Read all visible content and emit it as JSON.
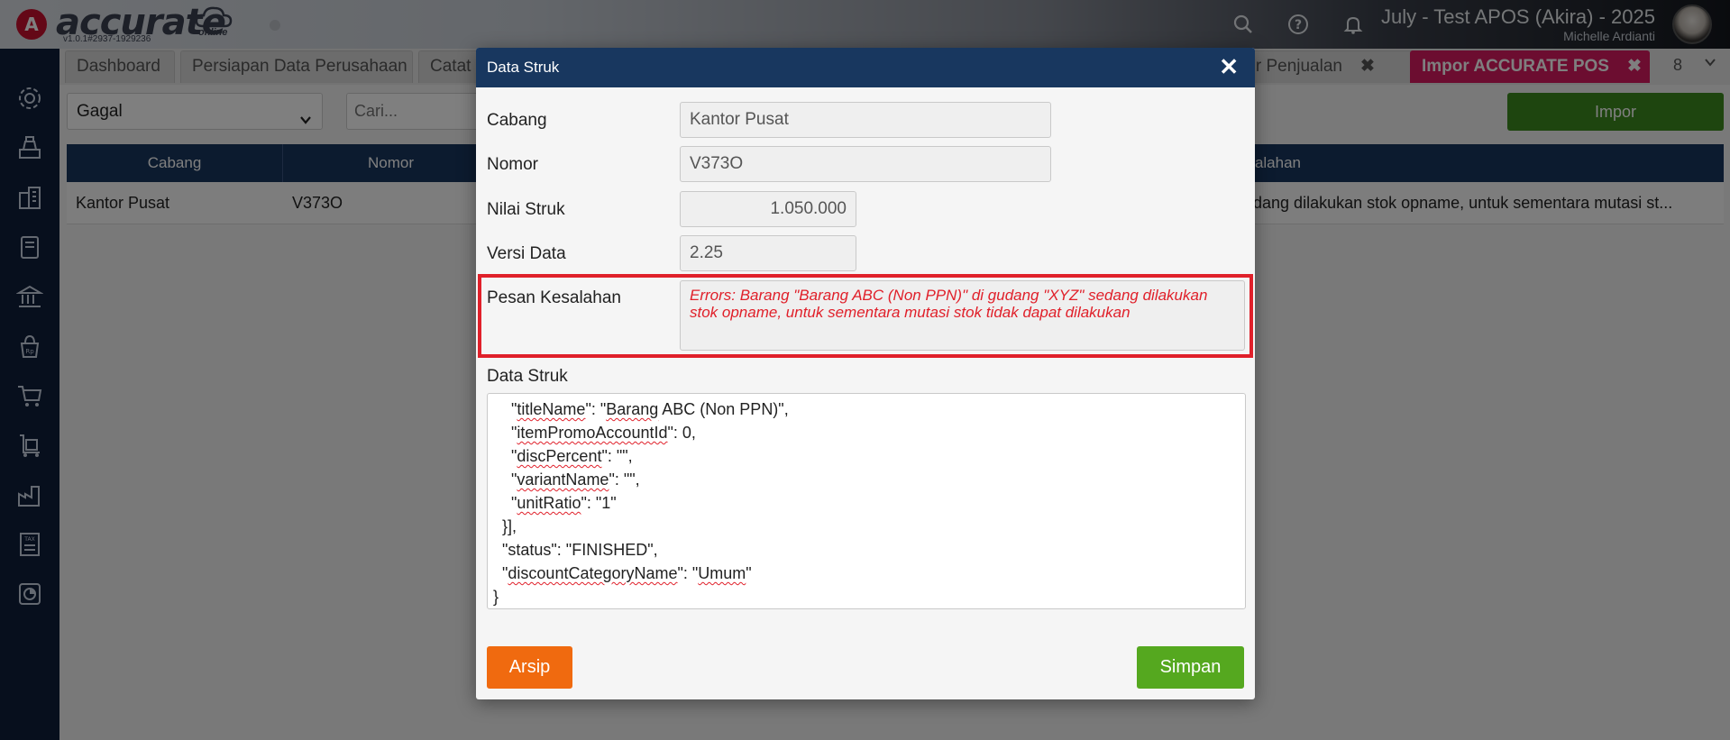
{
  "app": {
    "logo_letter": "A",
    "logo_text": "accurate",
    "logo_sub": "online",
    "version": "v1.0.1#2937-1929236",
    "company": "July - Test APOS (Akira) - 2025",
    "user": "Michelle Ardianti",
    "icons": [
      "search-icon",
      "help-icon",
      "bell-icon"
    ]
  },
  "sidebar": {
    "icons": [
      "gear-icon",
      "cash-register-icon",
      "buildings-icon",
      "book-icon",
      "bank-icon",
      "bag-icon",
      "cart-icon",
      "trolley-icon",
      "factory-icon",
      "tax-icon",
      "report-icon"
    ]
  },
  "tabs": [
    {
      "label": "Dashboard"
    },
    {
      "label": "Persiapan Data Perusahaan"
    },
    {
      "label": "Catat"
    },
    {
      "label": "tur Penjualan",
      "close": "✖"
    },
    {
      "label": "Impor ACCURATE POS",
      "close": "✖"
    }
  ],
  "tab_overflow": "8",
  "filter": {
    "status_value": "Gagal",
    "search_placeholder": "Cari...",
    "impor_label": "Impor"
  },
  "table": {
    "headers": [
      "Cabang",
      "Nomor",
      "esalahan"
    ],
    "rows": [
      {
        "cabang": "Kantor Pusat",
        "nomor": "V373O",
        "kesalahan": "edang dilakukan stok opname, untuk sementara mutasi st..."
      }
    ]
  },
  "modal": {
    "title": "Data Struk",
    "close": "✕",
    "fields": {
      "cabang_label": "Cabang",
      "cabang_value": "Kantor Pusat",
      "nomor_label": "Nomor",
      "nomor_value": "V373O",
      "nilai_label": "Nilai Struk",
      "nilai_value": "1.050.000",
      "versi_label": "Versi Data",
      "versi_value": "2.25",
      "pesan_label": "Pesan Kesalahan",
      "pesan_value": "Errors: Barang \"Barang ABC (Non PPN)\" di gudang \"XYZ\" sedang dilakukan stok opname, untuk sementara mutasi stok tidak dapat dilakukan",
      "data_label": "Data Struk"
    },
    "code_lines": [
      {
        "pre": "    \"",
        "key": "titleName",
        "post": "\": \"",
        "key2": "Barang",
        "post2": " ABC (Non PPN)\","
      },
      {
        "pre": "    \"",
        "key": "itemPromoAccountId",
        "post": "\": 0,",
        "key2": "",
        "post2": ""
      },
      {
        "pre": "    \"",
        "key": "discPercent",
        "post": "\": \"\",",
        "key2": "",
        "post2": ""
      },
      {
        "pre": "    \"",
        "key": "variantName",
        "post": "\": \"\",",
        "key2": "",
        "post2": ""
      },
      {
        "pre": "    \"",
        "key": "unitRatio",
        "post": "\": \"1\"",
        "key2": "",
        "post2": ""
      },
      {
        "pre": "  }],",
        "key": "",
        "post": "",
        "key2": "",
        "post2": ""
      },
      {
        "pre": "  \"status\": \"FINISHED\",",
        "key": "",
        "post": "",
        "key2": "",
        "post2": ""
      },
      {
        "pre": "  \"",
        "key": "discountCategoryName",
        "post": "\": \"",
        "key2": "Umum",
        "post2": "\""
      },
      {
        "pre": "}",
        "key": "",
        "post": "",
        "key2": "",
        "post2": ""
      }
    ],
    "arsip_label": "Arsip",
    "simpan_label": "Simpan"
  }
}
